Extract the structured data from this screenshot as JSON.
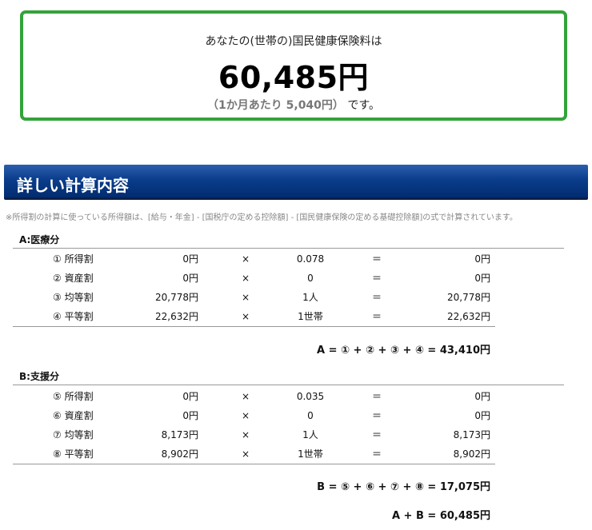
{
  "result": {
    "intro": "あなたの(世帯の)国民健康保険料は",
    "amount": "60,485円",
    "monthly_paren": "（1か月あたり 5,040円）",
    "monthly_suffix": "です。"
  },
  "details": {
    "heading": "詳しい計算内容",
    "note": "※所得割の計算に使っている所得額は、[給与・年金] - [国税庁の定める控除額] - [国民健康保険の定める基礎控除額]の式で計算されています。"
  },
  "section_a": {
    "label": "A:医療分",
    "rows": [
      {
        "name": "① 所得割",
        "base": "0円",
        "op": "×",
        "rate": "0.078",
        "eq": "＝",
        "result": "0円"
      },
      {
        "name": "② 資産割",
        "base": "0円",
        "op": "×",
        "rate": "0",
        "eq": "＝",
        "result": "0円"
      },
      {
        "name": "③ 均等割",
        "base": "20,778円",
        "op": "×",
        "rate": "1人",
        "eq": "＝",
        "result": "20,778円"
      },
      {
        "name": "④ 平等割",
        "base": "22,632円",
        "op": "×",
        "rate": "1世帯",
        "eq": "＝",
        "result": "22,632円"
      }
    ],
    "total": "A = ① + ② + ③ + ④ = 43,410円"
  },
  "section_b": {
    "label": "B:支援分",
    "rows": [
      {
        "name": "⑤ 所得割",
        "base": "0円",
        "op": "×",
        "rate": "0.035",
        "eq": "＝",
        "result": "0円"
      },
      {
        "name": "⑥ 資産割",
        "base": "0円",
        "op": "×",
        "rate": "0",
        "eq": "＝",
        "result": "0円"
      },
      {
        "name": "⑦ 均等割",
        "base": "8,173円",
        "op": "×",
        "rate": "1人",
        "eq": "＝",
        "result": "8,173円"
      },
      {
        "name": "⑧ 平等割",
        "base": "8,902円",
        "op": "×",
        "rate": "1世帯",
        "eq": "＝",
        "result": "8,902円"
      }
    ],
    "total": "B = ⑤ + ⑥ + ⑦ + ⑧ = 17,075円"
  },
  "grand_total": "A + B = 60,485円"
}
